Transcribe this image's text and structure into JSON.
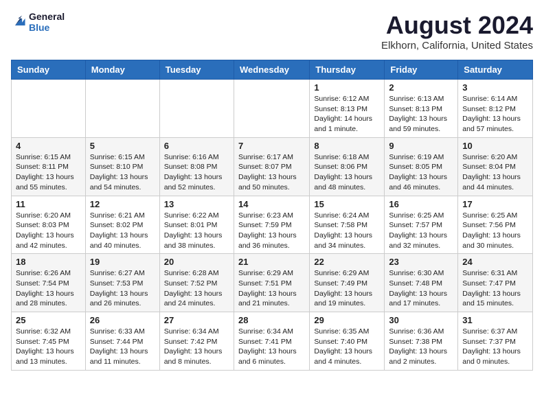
{
  "logo": {
    "general": "General",
    "blue": "Blue"
  },
  "title": "August 2024",
  "subtitle": "Elkhorn, California, United States",
  "weekdays": [
    "Sunday",
    "Monday",
    "Tuesday",
    "Wednesday",
    "Thursday",
    "Friday",
    "Saturday"
  ],
  "weeks": [
    [
      {
        "day": "",
        "detail": ""
      },
      {
        "day": "",
        "detail": ""
      },
      {
        "day": "",
        "detail": ""
      },
      {
        "day": "",
        "detail": ""
      },
      {
        "day": "1",
        "detail": "Sunrise: 6:12 AM\nSunset: 8:13 PM\nDaylight: 14 hours\nand 1 minute."
      },
      {
        "day": "2",
        "detail": "Sunrise: 6:13 AM\nSunset: 8:13 PM\nDaylight: 13 hours\nand 59 minutes."
      },
      {
        "day": "3",
        "detail": "Sunrise: 6:14 AM\nSunset: 8:12 PM\nDaylight: 13 hours\nand 57 minutes."
      }
    ],
    [
      {
        "day": "4",
        "detail": "Sunrise: 6:15 AM\nSunset: 8:11 PM\nDaylight: 13 hours\nand 55 minutes."
      },
      {
        "day": "5",
        "detail": "Sunrise: 6:15 AM\nSunset: 8:10 PM\nDaylight: 13 hours\nand 54 minutes."
      },
      {
        "day": "6",
        "detail": "Sunrise: 6:16 AM\nSunset: 8:08 PM\nDaylight: 13 hours\nand 52 minutes."
      },
      {
        "day": "7",
        "detail": "Sunrise: 6:17 AM\nSunset: 8:07 PM\nDaylight: 13 hours\nand 50 minutes."
      },
      {
        "day": "8",
        "detail": "Sunrise: 6:18 AM\nSunset: 8:06 PM\nDaylight: 13 hours\nand 48 minutes."
      },
      {
        "day": "9",
        "detail": "Sunrise: 6:19 AM\nSunset: 8:05 PM\nDaylight: 13 hours\nand 46 minutes."
      },
      {
        "day": "10",
        "detail": "Sunrise: 6:20 AM\nSunset: 8:04 PM\nDaylight: 13 hours\nand 44 minutes."
      }
    ],
    [
      {
        "day": "11",
        "detail": "Sunrise: 6:20 AM\nSunset: 8:03 PM\nDaylight: 13 hours\nand 42 minutes."
      },
      {
        "day": "12",
        "detail": "Sunrise: 6:21 AM\nSunset: 8:02 PM\nDaylight: 13 hours\nand 40 minutes."
      },
      {
        "day": "13",
        "detail": "Sunrise: 6:22 AM\nSunset: 8:01 PM\nDaylight: 13 hours\nand 38 minutes."
      },
      {
        "day": "14",
        "detail": "Sunrise: 6:23 AM\nSunset: 7:59 PM\nDaylight: 13 hours\nand 36 minutes."
      },
      {
        "day": "15",
        "detail": "Sunrise: 6:24 AM\nSunset: 7:58 PM\nDaylight: 13 hours\nand 34 minutes."
      },
      {
        "day": "16",
        "detail": "Sunrise: 6:25 AM\nSunset: 7:57 PM\nDaylight: 13 hours\nand 32 minutes."
      },
      {
        "day": "17",
        "detail": "Sunrise: 6:25 AM\nSunset: 7:56 PM\nDaylight: 13 hours\nand 30 minutes."
      }
    ],
    [
      {
        "day": "18",
        "detail": "Sunrise: 6:26 AM\nSunset: 7:54 PM\nDaylight: 13 hours\nand 28 minutes."
      },
      {
        "day": "19",
        "detail": "Sunrise: 6:27 AM\nSunset: 7:53 PM\nDaylight: 13 hours\nand 26 minutes."
      },
      {
        "day": "20",
        "detail": "Sunrise: 6:28 AM\nSunset: 7:52 PM\nDaylight: 13 hours\nand 24 minutes."
      },
      {
        "day": "21",
        "detail": "Sunrise: 6:29 AM\nSunset: 7:51 PM\nDaylight: 13 hours\nand 21 minutes."
      },
      {
        "day": "22",
        "detail": "Sunrise: 6:29 AM\nSunset: 7:49 PM\nDaylight: 13 hours\nand 19 minutes."
      },
      {
        "day": "23",
        "detail": "Sunrise: 6:30 AM\nSunset: 7:48 PM\nDaylight: 13 hours\nand 17 minutes."
      },
      {
        "day": "24",
        "detail": "Sunrise: 6:31 AM\nSunset: 7:47 PM\nDaylight: 13 hours\nand 15 minutes."
      }
    ],
    [
      {
        "day": "25",
        "detail": "Sunrise: 6:32 AM\nSunset: 7:45 PM\nDaylight: 13 hours\nand 13 minutes."
      },
      {
        "day": "26",
        "detail": "Sunrise: 6:33 AM\nSunset: 7:44 PM\nDaylight: 13 hours\nand 11 minutes."
      },
      {
        "day": "27",
        "detail": "Sunrise: 6:34 AM\nSunset: 7:42 PM\nDaylight: 13 hours\nand 8 minutes."
      },
      {
        "day": "28",
        "detail": "Sunrise: 6:34 AM\nSunset: 7:41 PM\nDaylight: 13 hours\nand 6 minutes."
      },
      {
        "day": "29",
        "detail": "Sunrise: 6:35 AM\nSunset: 7:40 PM\nDaylight: 13 hours\nand 4 minutes."
      },
      {
        "day": "30",
        "detail": "Sunrise: 6:36 AM\nSunset: 7:38 PM\nDaylight: 13 hours\nand 2 minutes."
      },
      {
        "day": "31",
        "detail": "Sunrise: 6:37 AM\nSunset: 7:37 PM\nDaylight: 13 hours\nand 0 minutes."
      }
    ]
  ]
}
